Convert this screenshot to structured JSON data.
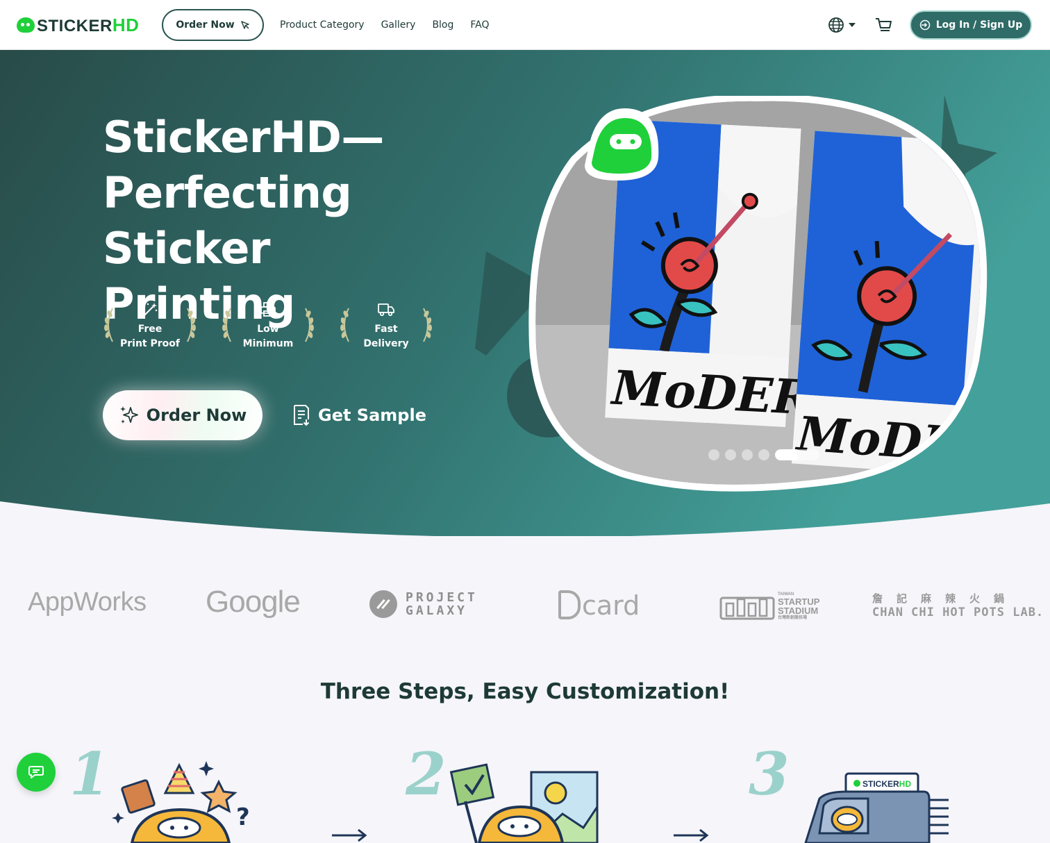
{
  "brand": {
    "name_prefix": "STICKER",
    "name_suffix": "HD"
  },
  "header": {
    "order_button": "Order Now",
    "nav": [
      "Product Category",
      "Gallery",
      "Blog",
      "FAQ"
    ],
    "login_button": "Log In / Sign Up"
  },
  "hero": {
    "title_lines": [
      "StickerHD—",
      "Perfecting Sticker",
      "Printing"
    ],
    "badges": [
      {
        "line1": "Free",
        "line2": "Print Proof",
        "icon": "magic-wand-icon"
      },
      {
        "line1": "Low",
        "line2": "Minimum",
        "icon": "printer-icon"
      },
      {
        "line1": "Fast",
        "line2": "Delivery",
        "icon": "truck-icon"
      }
    ],
    "order_button": "Order Now",
    "sample_link": "Get Sample",
    "carousel": {
      "slide_count": 6,
      "active_slide": 5,
      "sticker_word": "MoDERN"
    }
  },
  "partners": {
    "appworks": "AppWorks",
    "google": "Google",
    "galaxy_line1": "PROJECT",
    "galaxy_line2": "GALAXY",
    "dcard": "card",
    "startup_small": "TAIWAN",
    "startup_line1": "STARTUP",
    "startup_line2": "STADIUM",
    "startup_cn": "台灣新創競技場",
    "chanchi_cn": "詹記麻辣火鍋",
    "chanchi_en": "CHAN CHI HOT POTS LAB."
  },
  "steps": {
    "title": "Three Steps, Easy Customization!",
    "numbers": [
      "1",
      "2",
      "3"
    ],
    "truck_label_prefix": "STICKER",
    "truck_label_suffix": "HD"
  },
  "colors": {
    "brand_green": "#1fd03a",
    "hero_dark": "#2a524f",
    "hero_light": "#3f9893",
    "text_dark": "#1e3a36",
    "step_number": "#9bd1cb"
  }
}
